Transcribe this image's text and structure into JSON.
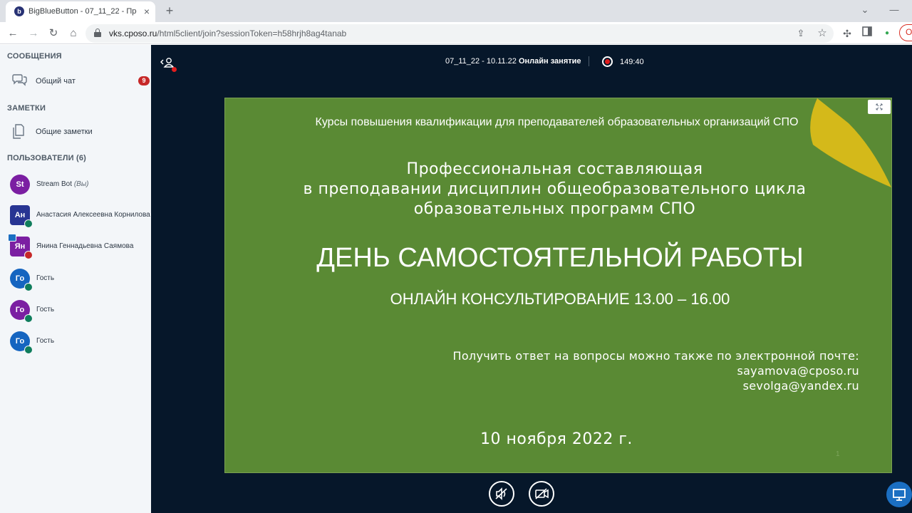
{
  "browser": {
    "tab_title": "BigBlueButton - 07_11_22 - Пре",
    "url_host": "vks.cposo.ru",
    "url_path": "/html5client/join?sessionToken=h58hrjh8ag4tanab",
    "favicon": "b"
  },
  "sidebar": {
    "messages_title": "СООБЩЕНИЯ",
    "public_chat_label": "Общий чат",
    "public_chat_badge": "9",
    "notes_title": "ЗАМЕТКИ",
    "shared_notes_label": "Общие заметки",
    "users_title": "ПОЛЬЗОВАТЕЛИ (6)",
    "users": [
      {
        "initials": "St",
        "name": "Stream Bot",
        "suffix": "(Вы)",
        "color": "#7b1fa2"
      },
      {
        "initials": "Ан",
        "name": "Анастасия Алексеевна Корнилова",
        "color": "#283593"
      },
      {
        "initials": "Ян",
        "name": "Янина Геннадьевна Саямова",
        "color": "#7b1fa2"
      },
      {
        "initials": "Го",
        "name": "Гость",
        "color": "#1565c0"
      },
      {
        "initials": "Го",
        "name": "Гость",
        "color": "#7b1fa2"
      },
      {
        "initials": "Го",
        "name": "Гость",
        "color": "#1565c0"
      }
    ]
  },
  "header": {
    "meeting_prefix": "07_11_22 - 10.11.22",
    "meeting_name": "Онлайн занятие",
    "recording_time": "149:40"
  },
  "slide": {
    "course": "Курсы повышения квалификации для преподавателей образовательных организаций СПО",
    "topic_line1": "Профессиональная составляющая",
    "topic_line2": "в преподавании дисциплин общеобразовательного цикла",
    "topic_line3": "образовательных программ СПО",
    "day_title": "ДЕНЬ САМОСТОЯТЕЛЬНОЙ РАБОТЫ",
    "consult": "ОНЛАЙН КОНСУЛЬТИРОВАНИЕ 13.00 – 16.00",
    "contact_line": "Получить ответ на вопросы можно также по электронной почте:",
    "email1": "sayamova@cposo.ru",
    "email2": "sevolga@yandex.ru",
    "date": "10 ноября 2022 г.",
    "page_number": "1"
  },
  "colors": {
    "slide_bg": "#5a8a34",
    "main_bg": "#06172a",
    "sidebar_bg": "#f3f6f9",
    "accent_blue": "#1b6fc2",
    "record_red": "#e11d1d",
    "leaf_yellow": "#d4b91a"
  }
}
